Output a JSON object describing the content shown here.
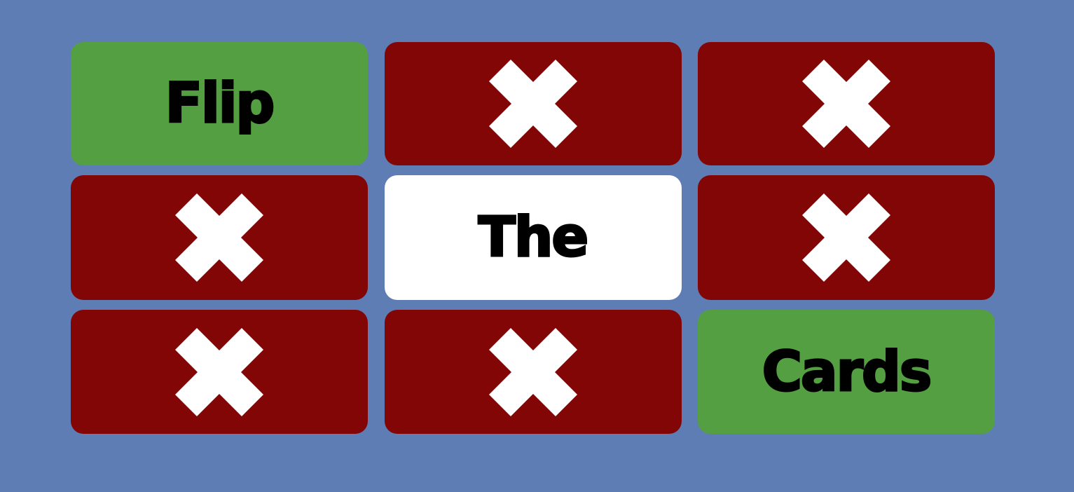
{
  "colors": {
    "background": "#5f7db5",
    "hidden_card": "#820606",
    "green_card": "#539f42",
    "white_card": "#ffffff",
    "text": "#000000",
    "x_icon": "#ffffff"
  },
  "cards": [
    {
      "state": "revealed",
      "style": "green",
      "label": "Flip"
    },
    {
      "state": "hidden",
      "icon": "x-icon"
    },
    {
      "state": "hidden",
      "icon": "x-icon"
    },
    {
      "state": "hidden",
      "icon": "x-icon"
    },
    {
      "state": "revealed",
      "style": "white",
      "label": "The"
    },
    {
      "state": "hidden",
      "icon": "x-icon"
    },
    {
      "state": "hidden",
      "icon": "x-icon"
    },
    {
      "state": "hidden",
      "icon": "x-icon"
    },
    {
      "state": "revealed",
      "style": "green",
      "label": "Cards"
    }
  ]
}
